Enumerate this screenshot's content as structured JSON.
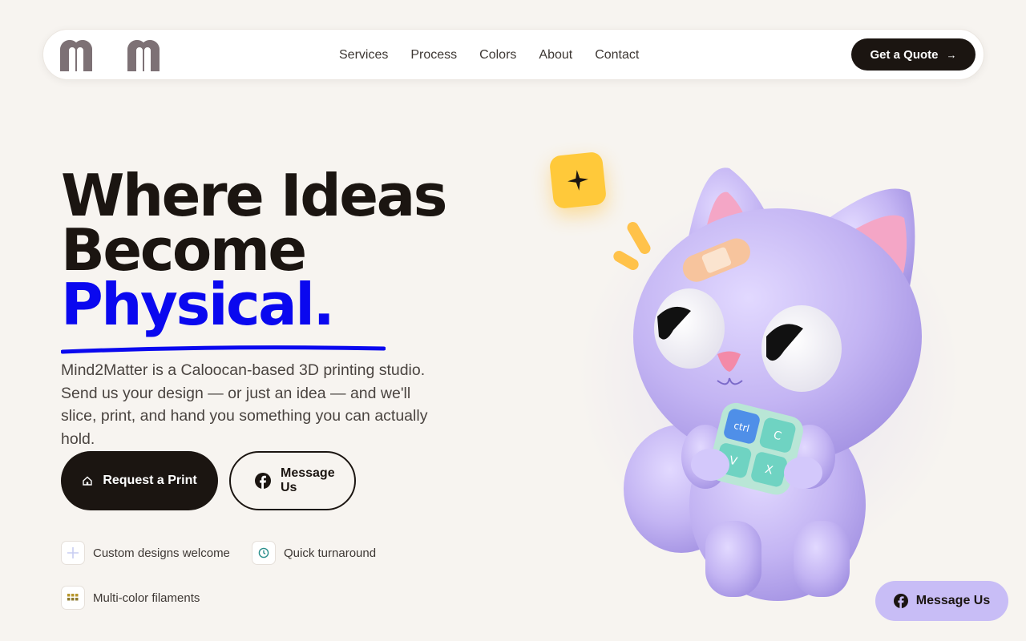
{
  "nav": {
    "links": [
      "Services",
      "Process",
      "Colors",
      "About",
      "Contact"
    ],
    "cta_label": "Get a Quote",
    "cta_icon": "arrow-right-icon"
  },
  "hero": {
    "headline_line1": "Where Ideas",
    "headline_line2": "Become",
    "headline_accent": "Physical.",
    "lede": "Mind2Matter is a Caloocan-based 3D printing studio. Send us your design — or just an idea — and we'll slice, print, and hand you something you can actually hold.",
    "primary_button": "Request a Print",
    "secondary_button": "Message Us",
    "features": [
      {
        "label": "Custom designs welcome",
        "icon": "plus-icon"
      },
      {
        "label": "Quick turnaround",
        "icon": "clock-icon"
      },
      {
        "label": "Multi-color filaments",
        "icon": "palette-grid-icon"
      }
    ]
  },
  "illustration": {
    "keycaps": [
      "ctrl",
      "C",
      "V",
      "X"
    ]
  },
  "floating_button": {
    "label": "Message Us",
    "icon": "facebook-icon"
  },
  "colors": {
    "accent": "#0a08ef",
    "dark": "#1b1511",
    "background": "#f7f4f0",
    "mascot": "#c3b4f3",
    "badge": "#ffc93a",
    "fab": "#c8bdf6"
  }
}
